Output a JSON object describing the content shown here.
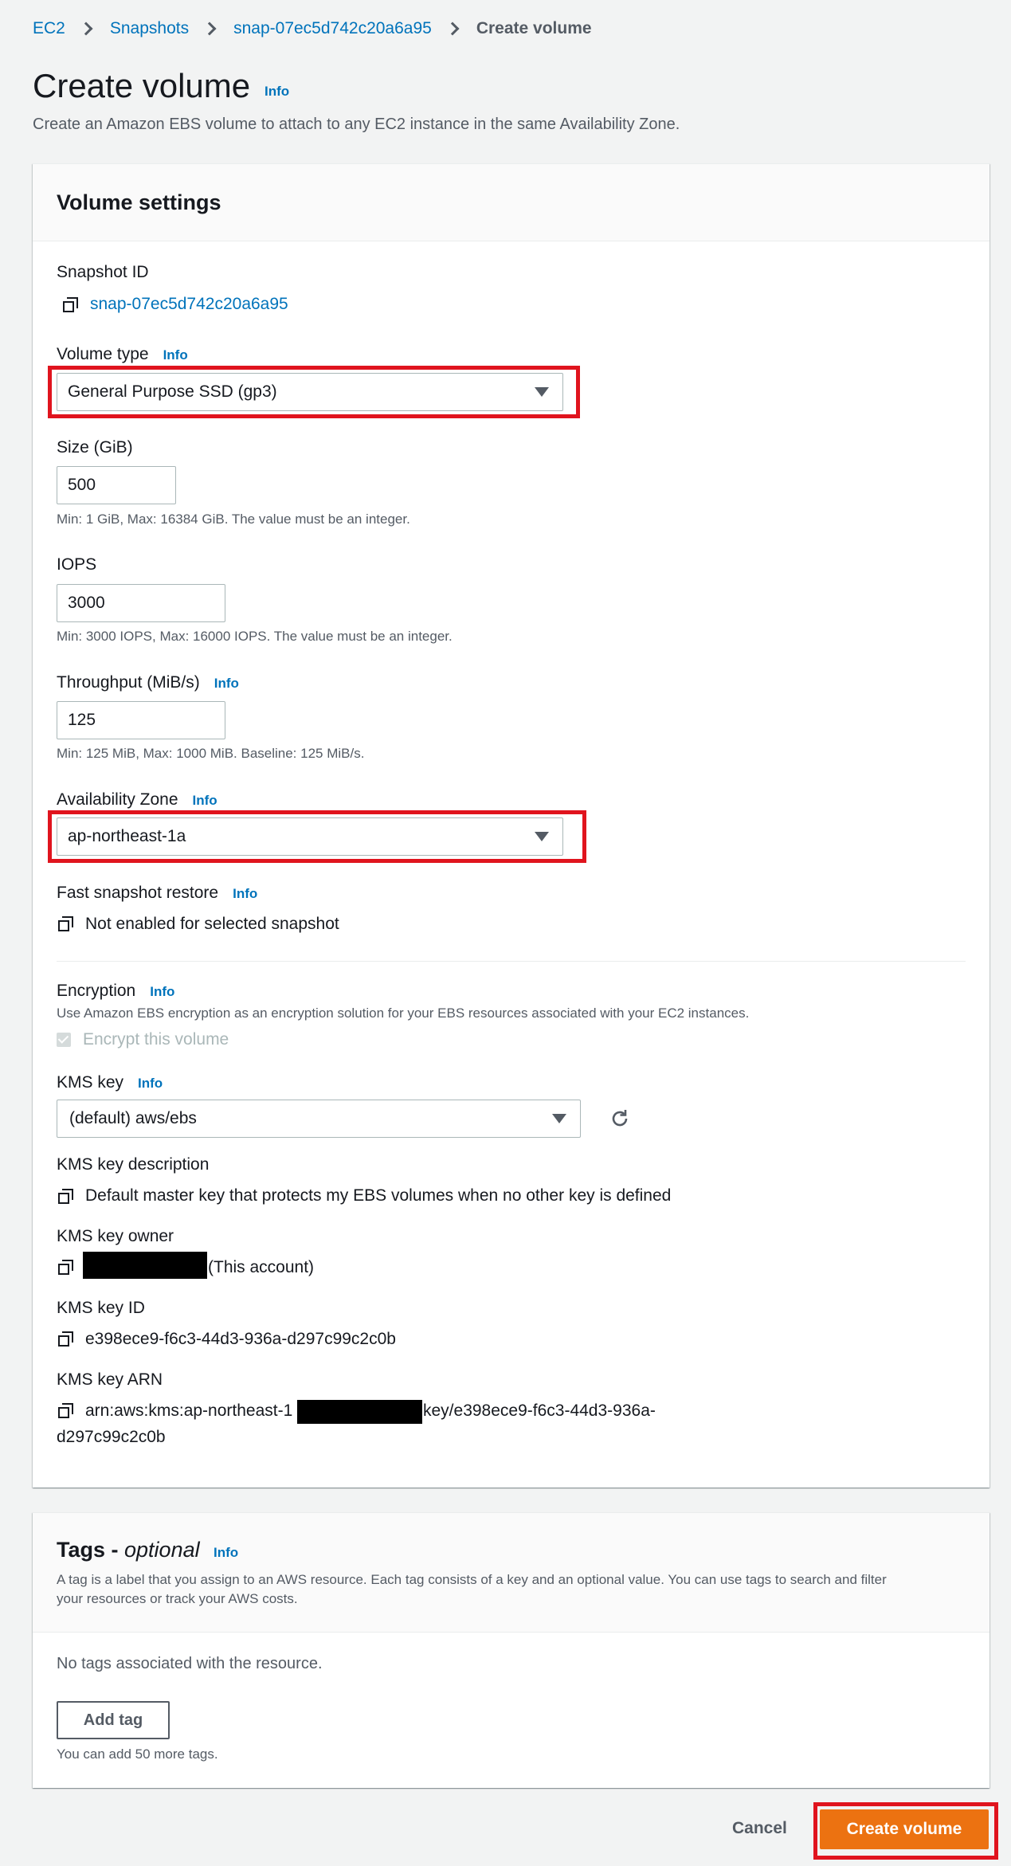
{
  "breadcrumb": {
    "items": [
      "EC2",
      "Snapshots",
      "snap-07ec5d742c20a6a95"
    ],
    "current": "Create volume"
  },
  "page": {
    "title": "Create volume",
    "info": "Info",
    "description": "Create an Amazon EBS volume to attach to any EC2 instance in the same Availability Zone."
  },
  "volume_settings": {
    "header": "Volume settings",
    "snapshot_id_label": "Snapshot ID",
    "snapshot_id": "snap-07ec5d742c20a6a95",
    "volume_type_label": "Volume type",
    "volume_type_info": "Info",
    "volume_type_value": "General Purpose SSD (gp3)",
    "size_label": "Size (GiB)",
    "size_value": "500",
    "size_hint": "Min: 1 GiB, Max: 16384 GiB. The value must be an integer.",
    "iops_label": "IOPS",
    "iops_value": "3000",
    "iops_hint": "Min: 3000 IOPS, Max: 16000 IOPS. The value must be an integer.",
    "throughput_label": "Throughput (MiB/s)",
    "throughput_info": "Info",
    "throughput_value": "125",
    "throughput_hint": "Min: 125 MiB, Max: 1000 MiB. Baseline: 125 MiB/s.",
    "az_label": "Availability Zone",
    "az_info": "Info",
    "az_value": "ap-northeast-1a",
    "fsr_label": "Fast snapshot restore",
    "fsr_info": "Info",
    "fsr_value": "Not enabled for selected snapshot",
    "encryption_label": "Encryption",
    "encryption_info": "Info",
    "encryption_hint": "Use Amazon EBS encryption as an encryption solution for your EBS resources associated with your EC2 instances.",
    "encrypt_checkbox_label": "Encrypt this volume",
    "kms_key_label": "KMS key",
    "kms_key_info": "Info",
    "kms_key_value": "(default) aws/ebs",
    "kms_desc_label": "KMS key description",
    "kms_desc_value": "Default master key that protects my EBS volumes when no other key is defined",
    "kms_owner_label": "KMS key owner",
    "kms_owner_suffix": "(This account)",
    "kms_id_label": "KMS key ID",
    "kms_id_value": "e398ece9-f6c3-44d3-936a-d297c99c2c0b",
    "kms_arn_label": "KMS key ARN",
    "kms_arn_prefix": "arn:aws:kms:ap-northeast-1",
    "kms_arn_suffix": "key/e398ece9-f6c3-44d3-936a-",
    "kms_arn_line2": "d297c99c2c0b"
  },
  "tags": {
    "title_prefix": "Tags - ",
    "title_optional": "optional",
    "info": "Info",
    "description_line1": "A tag is a label that you assign to an AWS resource. Each tag consists of a key and an optional value. You can use tags to search and filter",
    "description_line2": "your resources or track your AWS costs.",
    "empty_text": "No tags associated with the resource.",
    "add_button": "Add tag",
    "remaining_hint": "You can add 50 more tags."
  },
  "footer": {
    "cancel": "Cancel",
    "create": "Create volume"
  },
  "colors": {
    "accent": "#ec7211",
    "link": "#0073bb",
    "highlight": "#e0141e"
  },
  "icons": [
    "chevron-right-icon",
    "copy-icon",
    "caret-down-icon",
    "refresh-icon",
    "checkbox-checked-icon"
  ]
}
